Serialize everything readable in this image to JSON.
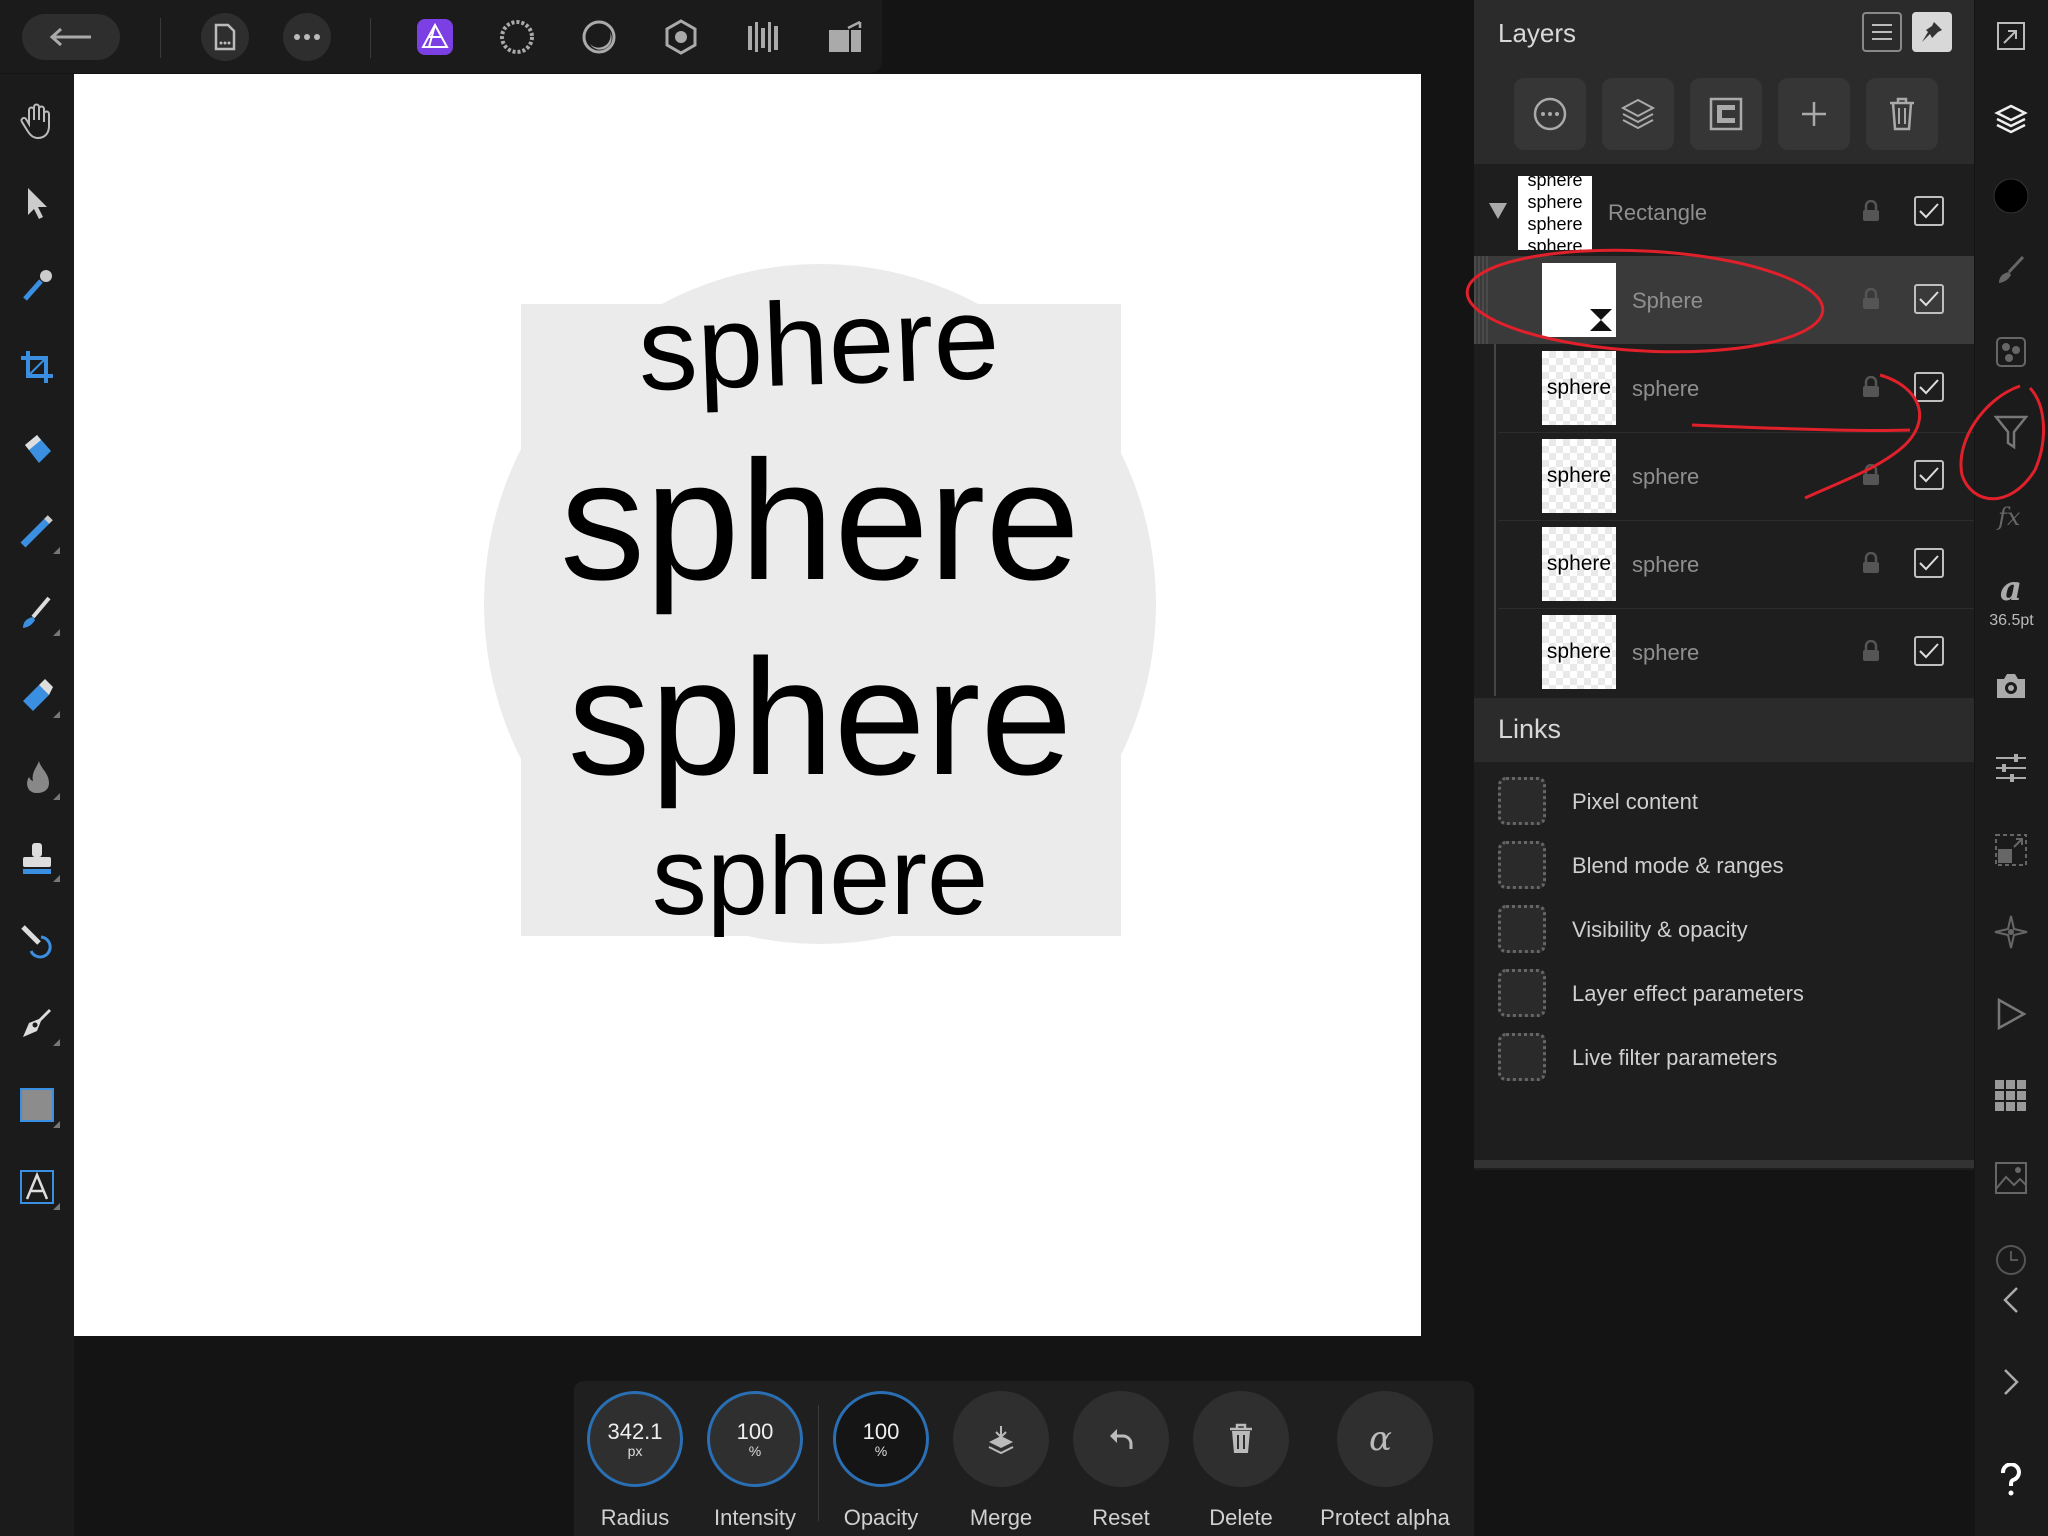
{
  "canvas": {
    "art_words": [
      "sphere",
      "sphere",
      "sphere",
      "sphere"
    ]
  },
  "top_toolbar": {
    "back_icon": "arrow-left-icon",
    "items": [
      "document-icon",
      "more-icon",
      "photo-persona-icon",
      "liquify-persona-icon",
      "develop-persona-icon",
      "tone-mapping-persona-icon",
      "export-persona-icon",
      "layout-icon"
    ]
  },
  "left_tools": [
    "hand-tool",
    "move-tool",
    "color-picker-tool",
    "crop-tool",
    "flood-fill-tool",
    "selection-brush-tool",
    "paint-brush-tool",
    "erase-brush-tool",
    "burn-brush-tool",
    "clone-brush-tool",
    "smudge-brush-tool",
    "pen-tool",
    "rectangle-tool",
    "text-tool"
  ],
  "layers_panel": {
    "title": "Layers",
    "group": {
      "name": "Rectangle",
      "thumb_lines": [
        "sphere",
        "sphere",
        "sphere",
        "sphere"
      ]
    },
    "layers": [
      {
        "name": "Sphere",
        "thumb": ""
      },
      {
        "name": "sphere",
        "thumb": "sphere"
      },
      {
        "name": "sphere",
        "thumb": "sphere"
      },
      {
        "name": "sphere",
        "thumb": "sphere"
      },
      {
        "name": "sphere",
        "thumb": "sphere"
      }
    ],
    "links_title": "Links",
    "links": [
      "Pixel content",
      "Blend mode & ranges",
      "Visibility & opacity",
      "Layer effect parameters",
      "Live filter parameters"
    ]
  },
  "studio_strip": {
    "font_size": "36.5pt"
  },
  "context_toolbar": {
    "radius": {
      "value": "342.1",
      "unit": "px",
      "label": "Radius"
    },
    "intensity": {
      "value": "100",
      "unit": "%",
      "label": "Intensity"
    },
    "opacity": {
      "value": "100",
      "unit": "%",
      "label": "Opacity"
    },
    "merge_label": "Merge",
    "reset_label": "Reset",
    "delete_label": "Delete",
    "protect_alpha_label": "Protect alpha"
  },
  "colors": {
    "accent_purple": "#7b3fe4",
    "annotation_red": "#e0202a",
    "ring_blue": "#2a6fb3"
  }
}
